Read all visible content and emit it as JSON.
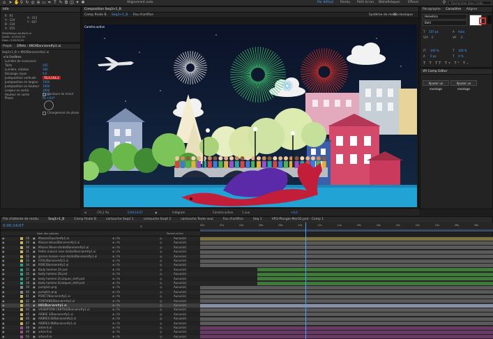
{
  "menu_bar": {
    "workspaces": [
      "Par défaut",
      "Rendu",
      "Petit écran",
      "Bibliothèques",
      "Effacer"
    ],
    "active_workspace": "Par défaut",
    "search_placeholder": "Rechercher dans l'aide",
    "autoalign_label": "Alignement auto"
  },
  "info_panel": {
    "title": "Info",
    "lines": [
      "R : 91",
      "V : 124",
      "B : 134",
      "A : 255",
      "X : 212",
      "Y : 937"
    ],
    "source_lines": [
      "Effet/Maison-fenêtre5.ai",
      "Durée : 0;00;02;03",
      "Dans : 0;00;00;20",
      "Sortie : 0;00;02;16"
    ]
  },
  "effects_panel": {
    "tabs": [
      "Projet",
      "Effets : KKO/Banniere#p1.ai"
    ],
    "breadcrumb": "Seq3>1_B > KKO/Banniere#p1.ai",
    "header": "Fenêtres",
    "rows": [
      {
        "label": "Lumière de croissance",
        "value": ""
      },
      {
        "label": "Taille",
        "value": "342"
      },
      {
        "label": "Lumière, rotation",
        "value": "160"
      },
      {
        "label": "Décalage rayon",
        "value": "0,0"
      },
      {
        "label": "Juxtaposition verticale",
        "value": "76,0,104,2"
      },
      {
        "label": "Juxtaposition en largeur",
        "value": "1504"
      },
      {
        "label": "Juxtaposition en hauteur",
        "value": "1000"
      },
      {
        "label": "Largeur en sortie",
        "value": "1904"
      },
      {
        "label": "Hauteur en sortie",
        "value": "1000"
      }
    ],
    "checkboxes": [
      "Contours du miroir",
      "Changement de phase"
    ],
    "phase_label": "Phase",
    "phase_value": "0x +0,0°"
  },
  "composition_panel": {
    "title": "Composition Seq3>1_B",
    "tabs": [
      "Comp finale B",
      "Seq3>1_B",
      "Feu d'artifice"
    ],
    "active_tab": "Seq3>1_B",
    "camera_label": "Caméra active",
    "renderer_label": "Système de rendu",
    "renderer_value": "3D classique",
    "footer": {
      "zoom": "(70,1 %)",
      "timecode": "0;00;14;07",
      "resolution": "Intégrale",
      "camera": "Caméra active",
      "views": "1 vue",
      "offset": "+0,0"
    }
  },
  "character_panel": {
    "tabs": [
      "Paragraphe",
      "Caractère",
      "Aligner"
    ],
    "font": "Helvetica",
    "style": "Bold",
    "size": "107 px",
    "leading": "Auto",
    "kerning": "0",
    "tracking": "0",
    "v_scale": "100 %",
    "h_scale": "100 %",
    "baseline": "0 px",
    "tsume": "0 %",
    "accent_color": "#d32f2f"
  },
  "comp_editor": {
    "title": "VR Comp Editor",
    "buttons": [
      "Ajouter un montage",
      "Ajouter un montage"
    ]
  },
  "timeline": {
    "tabs": [
      "File d'attente de rendu",
      "Seq3>1_B",
      "Comp finale B",
      "cartouche Seq4 1",
      "cartouche Seq4 2",
      "cartouche Texte seul",
      "Feu d'artifice",
      "Seq 1",
      "VR3-Planglo-Mer02.psd - Comp 1"
    ],
    "active_tab": "Seq3>1_B",
    "timecode": "0;00;14;07",
    "column_header_name": "Nom des calques",
    "column_header_parent": "Parent et lien",
    "rows": [
      {
        "num": "28",
        "name": "Maison/Gauche#p1.ai",
        "color": "#c8b35a"
      },
      {
        "num": "29",
        "name": "Maison-bleue/Banniere#p1.ai",
        "color": "#c8b35a"
      },
      {
        "num": "30",
        "name": "Maison Bleue-droite/Banniere#p1.ai",
        "color": "#c8b35a"
      },
      {
        "num": "31",
        "name": "Petite maison rose droite/Banniere#p1.ai",
        "color": "#c8b35a"
      },
      {
        "num": "32",
        "name": "grosse maison rose droite/Banniere#p1.ai",
        "color": "#c8b35a"
      },
      {
        "num": "33",
        "name": "FOUL/Banniere#p1.ai",
        "color": "#c8b35a"
      },
      {
        "num": "34",
        "name": "PORC/Banniere#p1.ai",
        "color": "#2fa38a"
      },
      {
        "num": "35",
        "name": "Body homme 2A.psd",
        "color": "#2fa38a"
      },
      {
        "num": "36",
        "name": "body homme 2B.psd",
        "color": "#2fa38a"
      },
      {
        "num": "37",
        "name": "body homme 2(calques_stefi.psd",
        "color": "#2fa38a"
      },
      {
        "num": "38",
        "name": "body homme 2(calques_stefi.psd",
        "color": "#2fa38a"
      },
      {
        "num": "39",
        "name": "pumpkin.png",
        "color": "#8a8a8a"
      },
      {
        "num": "40",
        "name": "pumpkin.png",
        "color": "#8a8a8a"
      },
      {
        "num": "41",
        "name": "PORCT/Banniere#p1.ai",
        "color": "#c8b35a"
      },
      {
        "num": "42",
        "name": "FONTAINE/Banniere#p1.ai",
        "color": "#c8b35a"
      },
      {
        "num": "43",
        "name": "KKO/Banniere#p1.ai",
        "color": "#c8b35a"
      },
      {
        "num": "44",
        "name": "VISSERTION CENTRE/Banniere#p1.ai",
        "color": "#c8b35a"
      },
      {
        "num": "45",
        "name": "ARBRE 3/Banniere#p1.ai",
        "color": "#c8b35a"
      },
      {
        "num": "46",
        "name": "ARBRES ID/Banniere#p1.ai",
        "color": "#c8b35a"
      },
      {
        "num": "47",
        "name": "ARBRES IN/Banniere#p1.ai",
        "color": "#c8b35a"
      },
      {
        "num": "48",
        "name": "arbre-4.ai",
        "color": "#a0508a"
      },
      {
        "num": "49",
        "name": "arbre-6.ai",
        "color": "#a0508a"
      },
      {
        "num": "50",
        "name": "arbre-6.ai",
        "color": "#a0508a"
      }
    ],
    "parent_value": "Aucun(e)",
    "ruler_marks": [
      "00s",
      "02s",
      "04s",
      "06s",
      "08s",
      "10s",
      "12s",
      "14s",
      "16s",
      "18s",
      "20s",
      "22s",
      "24s",
      "26s",
      "28s"
    ]
  }
}
